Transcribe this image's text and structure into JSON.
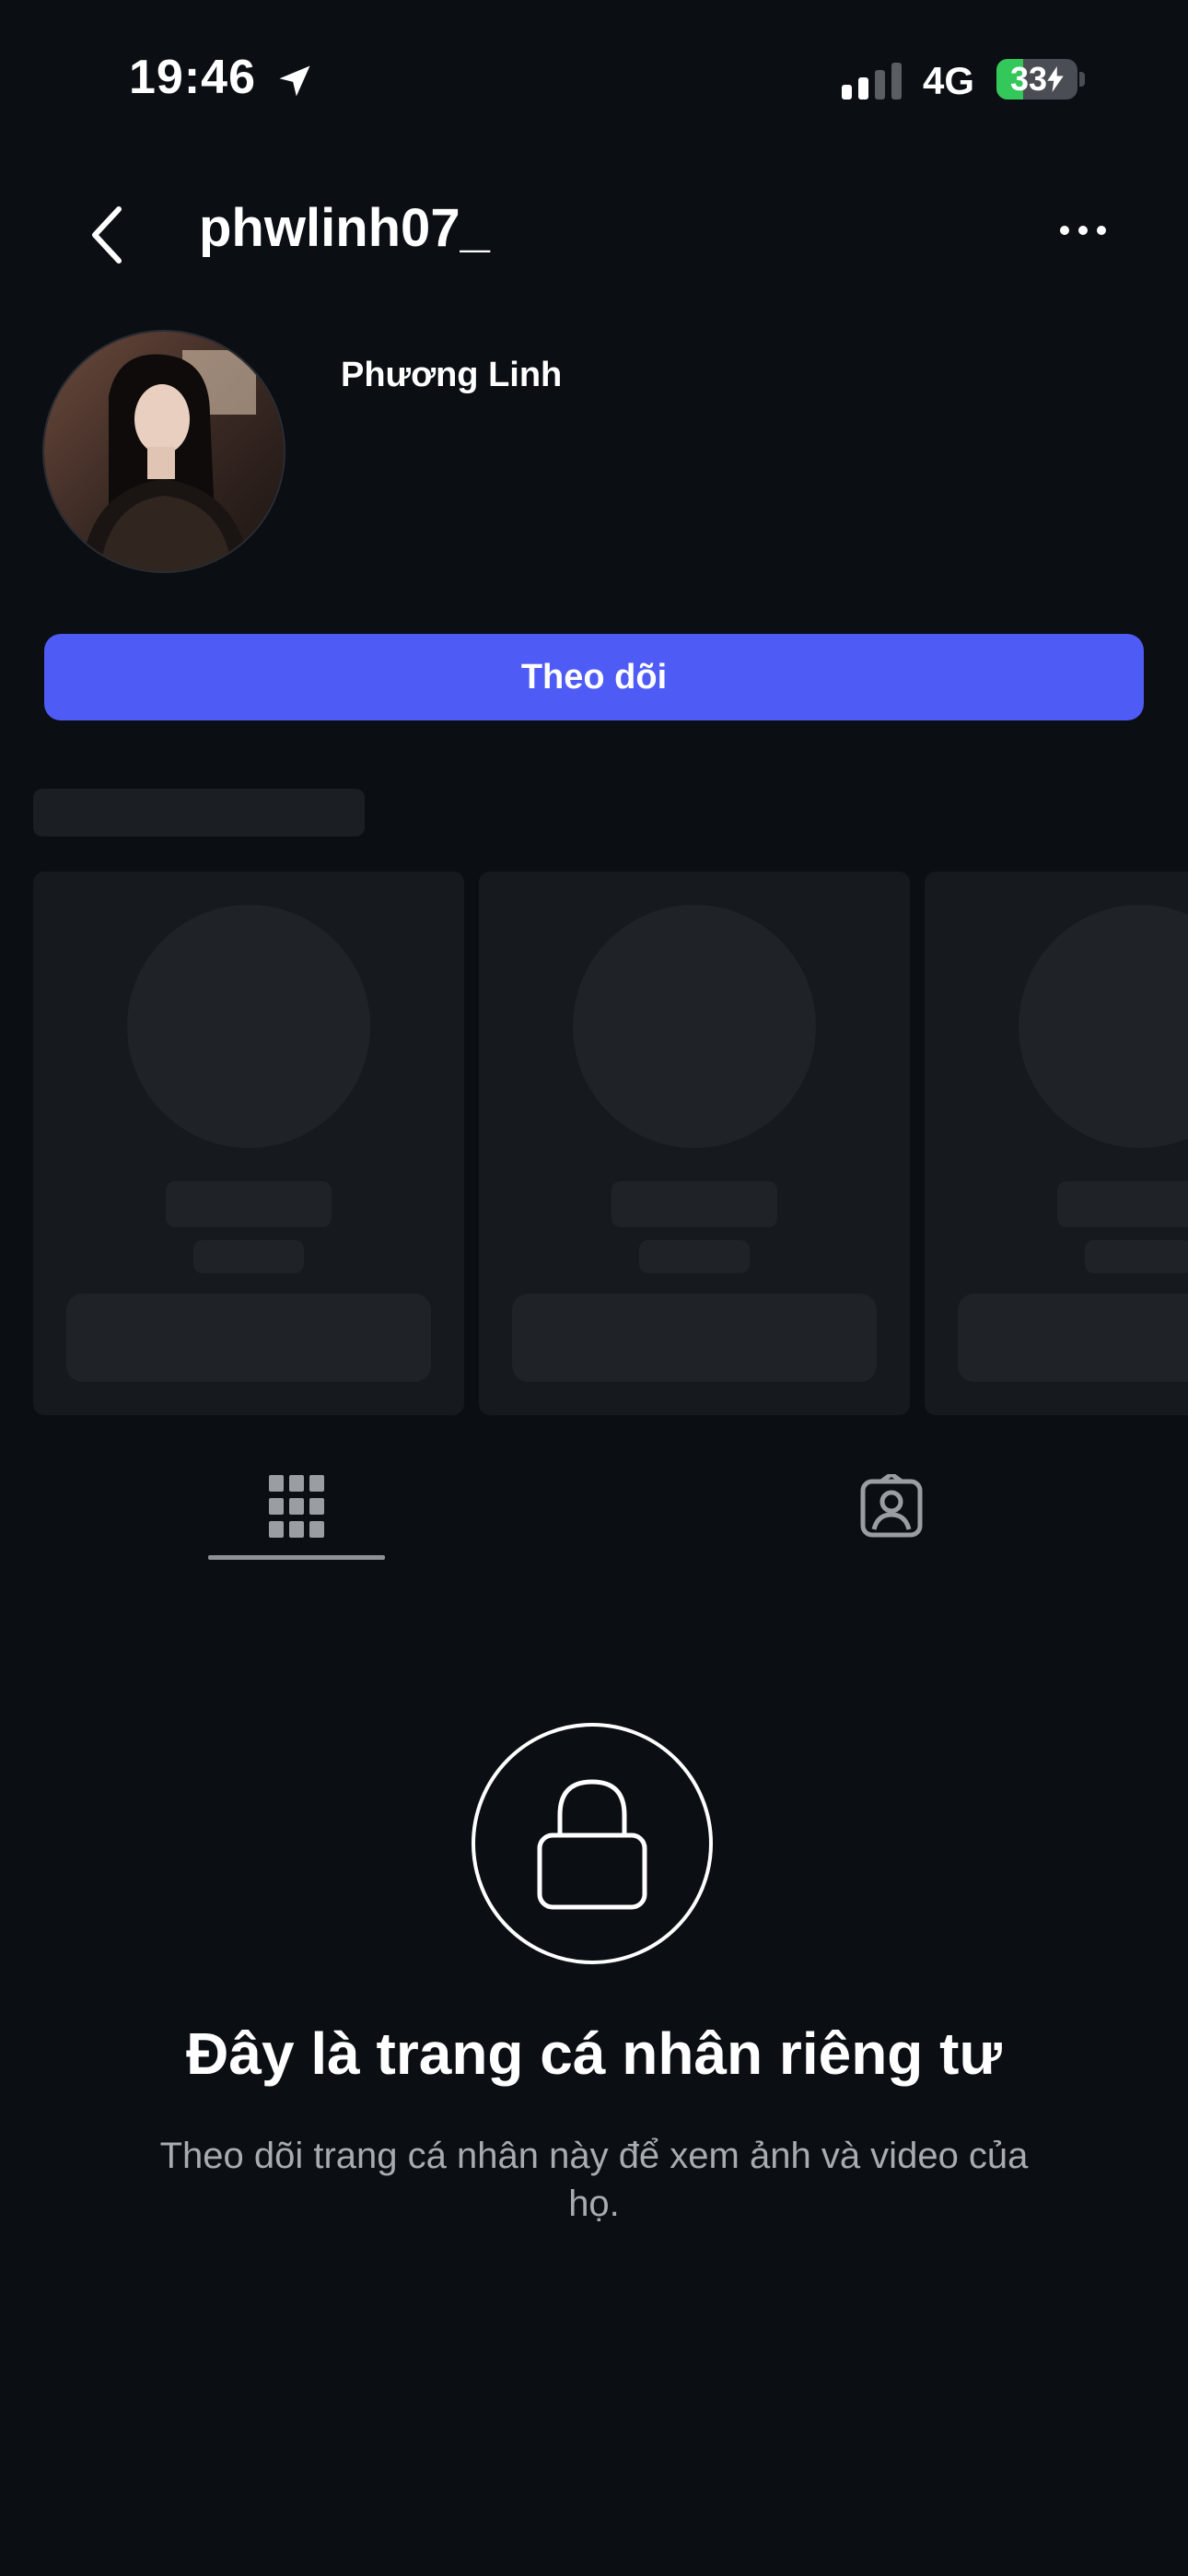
{
  "status_bar": {
    "time": "19:46",
    "network": "4G",
    "battery": "33",
    "battery_level": 0.33,
    "signal_bars": 2
  },
  "header": {
    "username": "phwlinh07_"
  },
  "profile": {
    "display_name": "Phương Linh",
    "follow_label": "Theo dõi"
  },
  "tabs": [
    {
      "name": "posts-grid",
      "icon": "grid-icon",
      "active": true
    },
    {
      "name": "tagged",
      "icon": "tagged-person-icon",
      "active": false
    }
  ],
  "private_notice": {
    "title": "Đây là trang cá nhân riêng tư",
    "description": "Theo dõi trang cá nhân này để xem ảnh và video của họ."
  },
  "colors": {
    "background": "#0b0e13",
    "accent": "#4f5bf5",
    "battery_green": "#34c759",
    "muted_text": "#a8abb0"
  }
}
